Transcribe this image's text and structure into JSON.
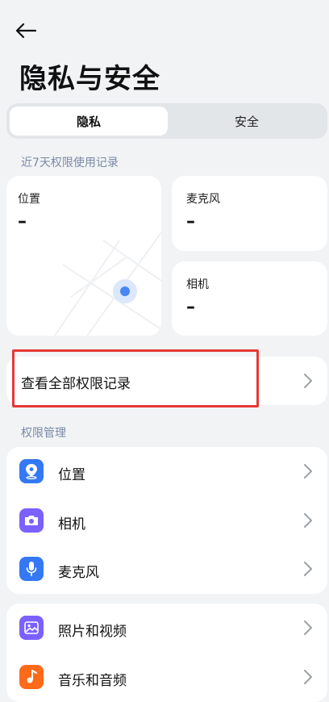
{
  "header": {
    "title": "隐私与安全"
  },
  "tabs": [
    {
      "label": "隐私",
      "active": true
    },
    {
      "label": "安全",
      "active": false
    }
  ],
  "recent": {
    "section_label": "近7天权限使用记录",
    "location": {
      "label": "位置",
      "value": "–"
    },
    "microphone": {
      "label": "麦克风",
      "value": "–"
    },
    "camera": {
      "label": "相机",
      "value": "–"
    }
  },
  "all_records": {
    "label": "查看全部权限记录"
  },
  "permissions": {
    "section_label": "权限管理",
    "items": [
      {
        "label": "位置",
        "icon": "location-icon",
        "color": "#3478f6"
      },
      {
        "label": "相机",
        "icon": "camera-icon",
        "color": "#7b61ff"
      },
      {
        "label": "麦克风",
        "icon": "microphone-icon",
        "color": "#3478f6"
      }
    ]
  },
  "media": {
    "items": [
      {
        "label": "照片和视频",
        "icon": "photo-icon",
        "color": "#7b61ff"
      },
      {
        "label": "音乐和音频",
        "icon": "music-icon",
        "color": "#ff6a1a"
      }
    ]
  },
  "colors": {
    "accent_blue": "#3478f6",
    "highlight_red": "#e53935"
  }
}
